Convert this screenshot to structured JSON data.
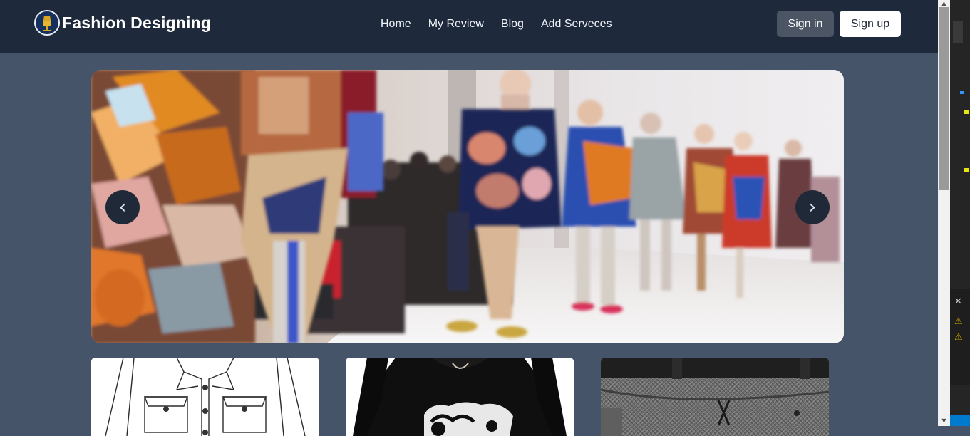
{
  "header": {
    "brand": "Fashion Designing",
    "nav": [
      "Home",
      "My Review",
      "Blog",
      "Add Serveces"
    ],
    "signin_label": "Sign in",
    "signup_label": "Sign up"
  },
  "carousel": {
    "prev_label": "‹",
    "next_label": "›"
  },
  "scrollbar": {
    "up_arrow": "▲",
    "down_arrow": "▼"
  },
  "side_panel": {
    "close": "✕",
    "warning": "⚠"
  },
  "icons": {
    "logo": "dress-form-icon",
    "carousel_prev": "chevron-left-icon",
    "carousel_next": "chevron-right-icon"
  },
  "colors": {
    "navbar": "#1e293b",
    "page_bg": "#46546a",
    "signin_bg": "#4b5563",
    "signup_bg": "#ffffff"
  }
}
